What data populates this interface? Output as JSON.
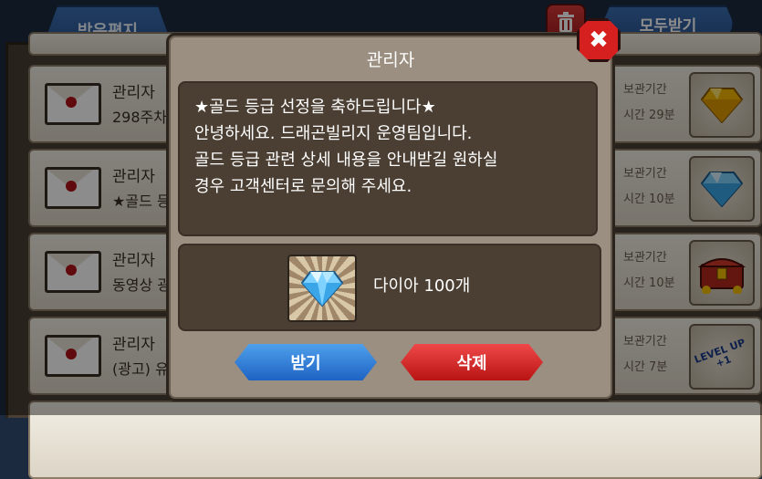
{
  "inbox": {
    "tab_label": "받은편지",
    "receive_all_label": "모두받기",
    "items": [
      {
        "sender": "관리자",
        "subject": "298주차",
        "deadline": "보관기간",
        "remaining": "시간 29분",
        "reward": "gold-diamond"
      },
      {
        "sender": "관리자",
        "subject": "★골드 등",
        "deadline": "보관기간",
        "remaining": "시간 10분",
        "reward": "blue-diamond"
      },
      {
        "sender": "관리자",
        "subject": "동영상 광",
        "deadline": "보관기간",
        "remaining": "시간 10분",
        "reward": "treasure-chest"
      },
      {
        "sender": "관리자",
        "subject": "(광고) 유",
        "deadline": "보관기간",
        "remaining": "시간 7분",
        "reward": "level-up-badge"
      }
    ],
    "level_badge_text": "LEVEL UP +1"
  },
  "modal": {
    "title": "관리자",
    "message_lines": [
      "★골드 등급 선정을 축하드립니다★",
      "안녕하세요. 드래곤빌리지 운영팀입니다.",
      "골드 등급 관련 상세 내용을 안내받길 원하실",
      "경우 고객센터로 문의해 주세요."
    ],
    "reward_label": "다이아 100개",
    "receive_button": "받기",
    "delete_button": "삭제",
    "close_icon": "✖"
  },
  "colors": {
    "accent_blue": "#2a5594",
    "delete_red": "#b81414",
    "panel_brown": "#4b3f33"
  }
}
